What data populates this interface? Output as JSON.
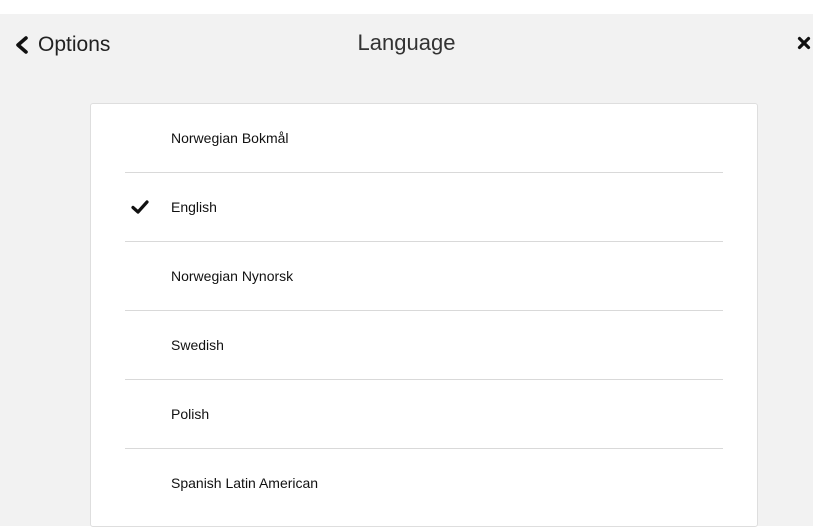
{
  "header": {
    "back_label": "Options",
    "title": "Language"
  },
  "languages": [
    {
      "label": "Norwegian Bokmål",
      "selected": false
    },
    {
      "label": "English",
      "selected": true
    },
    {
      "label": "Norwegian Nynorsk",
      "selected": false
    },
    {
      "label": "Swedish",
      "selected": false
    },
    {
      "label": "Polish",
      "selected": false
    },
    {
      "label": "Spanish Latin American",
      "selected": false
    }
  ],
  "icons": {
    "back": "chevron-left-icon",
    "close": "close-icon",
    "selected": "checkmark-icon"
  },
  "colors": {
    "panel_background": "#f2f2f2",
    "card_background": "#ffffff",
    "divider": "#d9d9d9",
    "text": "#222222"
  }
}
